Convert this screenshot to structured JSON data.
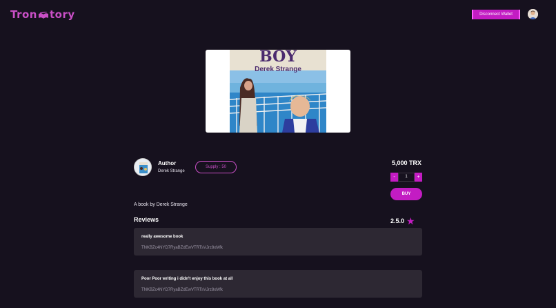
{
  "header": {
    "logo_left": "Tron",
    "logo_right": "tory",
    "wallet_button": "Disconnect Wallet",
    "brand_color": "#c94fc6"
  },
  "cover": {
    "title": "BOY",
    "author": "Derek Strange"
  },
  "author": {
    "heading": "Author",
    "name": "Derek Strange"
  },
  "supply_label": "Supply : 50",
  "price": "5,000 TRX",
  "quantity": {
    "minus": "-",
    "value": "1",
    "plus": "+"
  },
  "buy_label": "BUY",
  "description": "A book by Derek Strange",
  "reviews": {
    "title": "Reviews",
    "rating": "2.5.0",
    "items": [
      {
        "text": "really awesome book",
        "address": "TNKBZc4NYD7RyaBZdEwVTRTsVJrz8xMfk"
      },
      {
        "text": "Poor Poor writing i didn't enjoy this book at all",
        "address": "TNKBZc4NYD7RyaBZdEwVTRTsVJrz8xMfk"
      }
    ]
  },
  "accent_color": "#c31cc3"
}
